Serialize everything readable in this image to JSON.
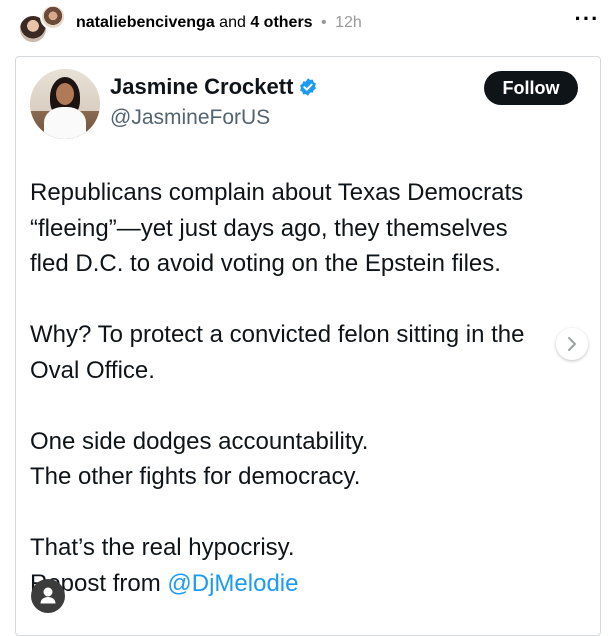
{
  "post_header": {
    "username": "nataliebencivenga",
    "and_text": "and",
    "others": "4 others",
    "separator": "•",
    "time": "12h",
    "more_label": "···"
  },
  "tweet": {
    "name": "Jasmine Crockett",
    "handle": "@JasmineForUS",
    "follow_label": "Follow",
    "paragraphs": [
      [
        "Republicans complain about Texas Democrats",
        "“fleeing”—yet just days ago, they themselves",
        "fled D.C. to avoid voting on the Epstein files."
      ],
      [
        "Why? To protect a convicted felon sitting in the",
        "Oval Office."
      ],
      [
        "One side dodges accountability.",
        "The other fights for democracy."
      ],
      [
        "That’s the real hypocrisy."
      ]
    ],
    "repost_prefix": "Repost from",
    "repost_mention": "@DjMelodie"
  },
  "icons": {
    "verified": "verified-badge-icon",
    "next": "chevron-right-icon",
    "user_tag": "user-tag-icon"
  },
  "colors": {
    "link": "#1d9bf0",
    "follow_bg": "#0f1419",
    "verified": "#1d9bf0"
  }
}
